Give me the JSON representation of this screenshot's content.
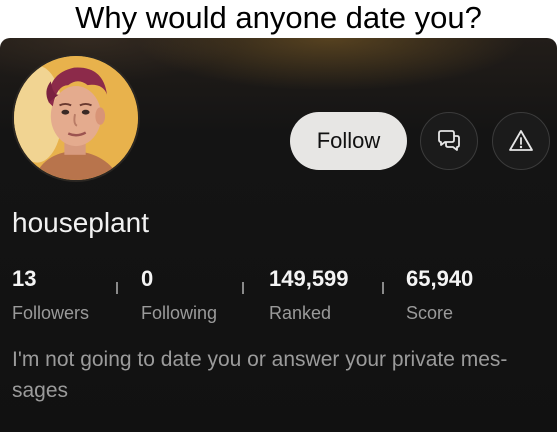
{
  "caption": "Why would anyone date you?",
  "profile": {
    "avatar_icon": "profile-photo",
    "username": "houseplant",
    "bio": "I'm not going to date you or answer your private mes-sages"
  },
  "actions": {
    "follow_label": "Follow",
    "message_icon": "message-icon",
    "report_icon": "warning-icon"
  },
  "stats": [
    {
      "value": "13",
      "label": "Followers"
    },
    {
      "value": "0",
      "label": "Following"
    },
    {
      "value": "149,599",
      "label": "Ranked"
    },
    {
      "value": "65,940",
      "label": "Score"
    }
  ],
  "colors": {
    "card_background": "#111111",
    "follow_button": "#e7e6e4",
    "primary_text": "#f2f2f2",
    "secondary_text": "#9a9a9a"
  }
}
